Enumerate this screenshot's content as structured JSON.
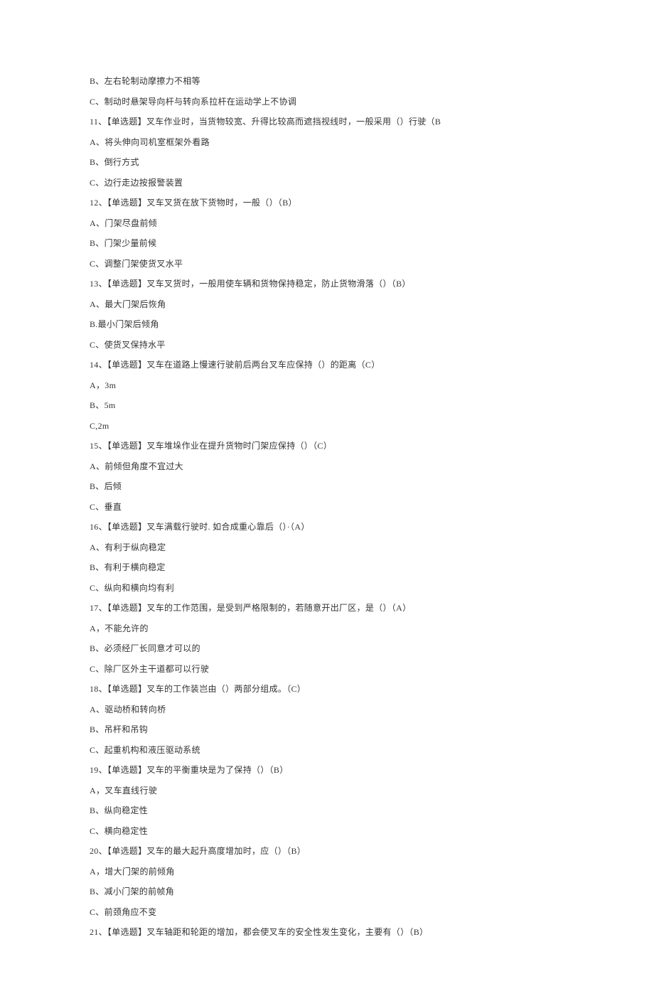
{
  "lines": [
    "B、左右轮制动摩擦力不相等",
    "C、制动时悬架导向杆与转向系拉杆在运动学上不协调",
    "11、【单选题】叉车作业时，当货物较宽、升得比较高而遮挡视线时，一般采用（）行驶（B",
    "A、将头伸向司机室框架外看路",
    "B、倒行方式",
    "C、边行走边按报警装置",
    "12、【单选题】叉车叉货在放下货物时，一般（）（B）",
    "A、门架尽盘前倾",
    "B、门架少量前候",
    "C、调整门架使货叉水平",
    "13、【单选题】叉车叉货时，一般用使车辆和货物保持稳定，防止货物滑落（）（B）",
    "A、最大门架后恢角",
    "B.最小门架后倾角",
    "C、使货叉保持水平",
    "14、【单选题】叉车在道路上慢速行驶前后两台叉车应保持（）的距离（C）",
    "A，3m",
    "B、5m",
    "C,2m",
    "15、【单选题】叉车堆垛作业在提升货物时门架应保持（）（C）",
    "A、前倾但角度不宜过大",
    "B、后倾",
    "C、垂直",
    "16、【单选题】叉车满载行驶时. 如合成重心靠后（）·（A）",
    "A、有利于纵向稳定",
    "B、有利于横向稳定",
    "C、纵向和横向均有利",
    "17、【单选题】叉车的工作范围，是受到严格限制的，若随意开出厂区，是（）（A）",
    "A，不能允许的",
    "B、必须经厂长同意才可以的",
    "C、除厂区外主干道都可以行驶",
    "18、【单选题】叉车的工作装岂由（）两部分组成。（C）",
    "A、驱动桥和转向桥",
    "B、吊杆和吊钩",
    "C、起重机构和液压驱动系统",
    "19、【单选题】叉车的平衡重块是为了保持（）（B）",
    "A，叉车直线行驶",
    "B、纵向稳定性",
    "C、横向稳定性",
    "20、【单选题】叉车的最大起升高度增加时，应（）（B）",
    "A，增大门架的前倾角",
    "B、减小门架的前帧角",
    "C、前颈角应不变",
    "21、【单选题】叉车轴距和轮距的增加，都会使叉车的安全性发生变化，主要有（）（B）"
  ]
}
